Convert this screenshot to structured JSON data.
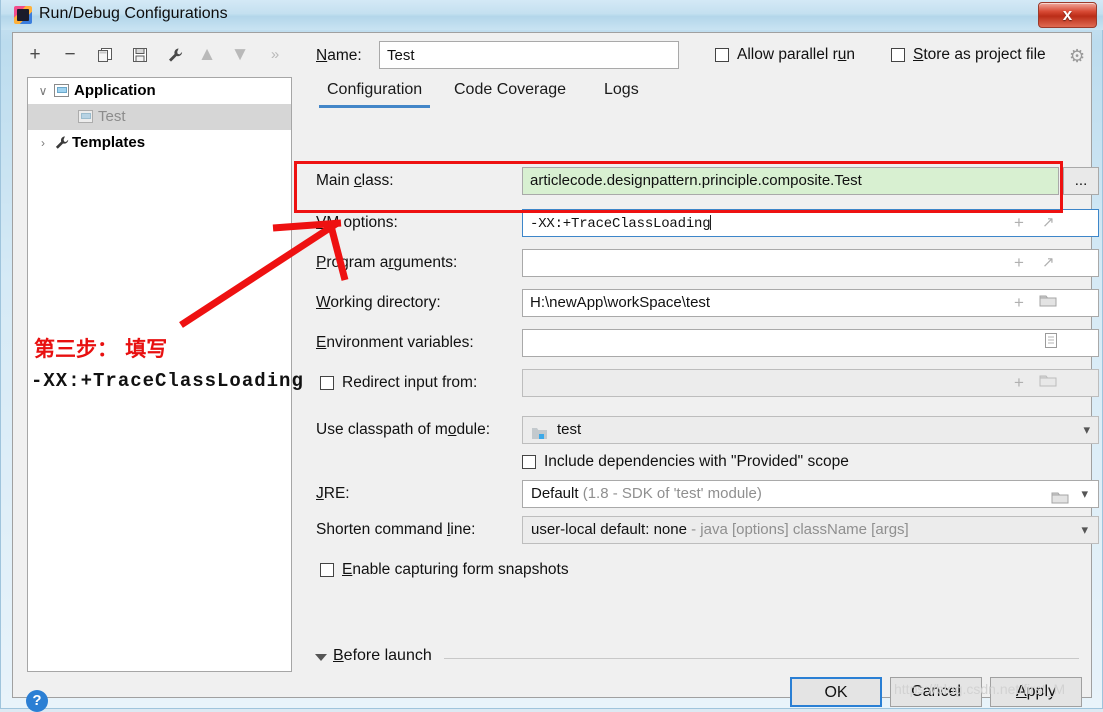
{
  "window": {
    "title": "Run/Debug Configurations",
    "close_label": "x",
    "app_icon": "intellij-idea-icon"
  },
  "toolbar": {
    "buttons": [
      {
        "name": "add-configuration",
        "glyph": "+",
        "enabled": true
      },
      {
        "name": "remove-configuration",
        "glyph": "−",
        "enabled": true
      },
      {
        "name": "copy-configuration",
        "glyph": "copy-icon",
        "enabled": true
      },
      {
        "name": "save-configuration",
        "glyph": "save-icon",
        "enabled": true
      },
      {
        "name": "edit-templates",
        "glyph": "wrench-icon",
        "enabled": true
      },
      {
        "name": "move-up",
        "glyph": "▲",
        "enabled": false
      },
      {
        "name": "move-down",
        "glyph": "▼",
        "enabled": false
      },
      {
        "name": "more-options",
        "glyph": "»",
        "enabled": false
      }
    ]
  },
  "tree": {
    "items": [
      {
        "label": "Application",
        "twisty": "∨",
        "icon": "application-window-icon",
        "bold": true,
        "indent": 46,
        "selected": false
      },
      {
        "label": "Test",
        "twisty": "",
        "icon": "application-window-icon",
        "bold": false,
        "indent": 70,
        "selected": true
      },
      {
        "label": "Templates",
        "twisty": "›",
        "icon": "wrench-icon",
        "bold": true,
        "indent": 46,
        "selected": false
      }
    ]
  },
  "header": {
    "name_label": "Name:",
    "name_value": "Test",
    "allow_parallel_run_label": "Allow parallel run",
    "allow_parallel_run_checked": false,
    "store_as_project_file_label": "Store as project file",
    "store_as_project_file_checked": false,
    "gear_icon": "gear-icon"
  },
  "tabs": [
    {
      "label": "Configuration",
      "active": true
    },
    {
      "label": "Code Coverage",
      "active": false
    },
    {
      "label": "Logs",
      "active": false
    }
  ],
  "form": {
    "main_class": {
      "label": "Main class:",
      "value": "articlecode.designpattern.principle.composite.Test",
      "browse_label": "..."
    },
    "vm_options": {
      "label": "VM options:",
      "value": "-XX:+TraceClassLoading",
      "focused": true
    },
    "program_arguments": {
      "label": "Program arguments:",
      "value": ""
    },
    "working_directory": {
      "label": "Working directory:",
      "value": "H:\\newApp\\workSpace\\test"
    },
    "environment_variables": {
      "label": "Environment variables:",
      "value": ""
    },
    "redirect_input": {
      "label": "Redirect input from:",
      "checked": false,
      "value": ""
    },
    "use_classpath_of_module": {
      "label": "Use classpath of module:",
      "value": "test",
      "icon": "module-icon"
    },
    "include_provided": {
      "label": "Include dependencies with \"Provided\" scope",
      "checked": false
    },
    "jre": {
      "label": "JRE:",
      "value": "Default",
      "hint": "(1.8 - SDK of 'test' module)"
    },
    "shorten_command_line": {
      "label": "Shorten command line:",
      "value": "user-local default: none",
      "hint": "- java [options] className [args]"
    },
    "enable_form_snapshots": {
      "label": "Enable capturing form snapshots",
      "checked": false
    }
  },
  "before_launch": {
    "label": "Before launch"
  },
  "buttons": {
    "ok": "OK",
    "cancel": "Cancel",
    "apply": "Apply",
    "help": "?"
  },
  "annotations": {
    "step_note": "第三步： 填写",
    "step_code": "-XX:+TraceClassLoading",
    "highlight_color": "#ee1111"
  },
  "watermark": "https://blog.csdn.net/first_M"
}
